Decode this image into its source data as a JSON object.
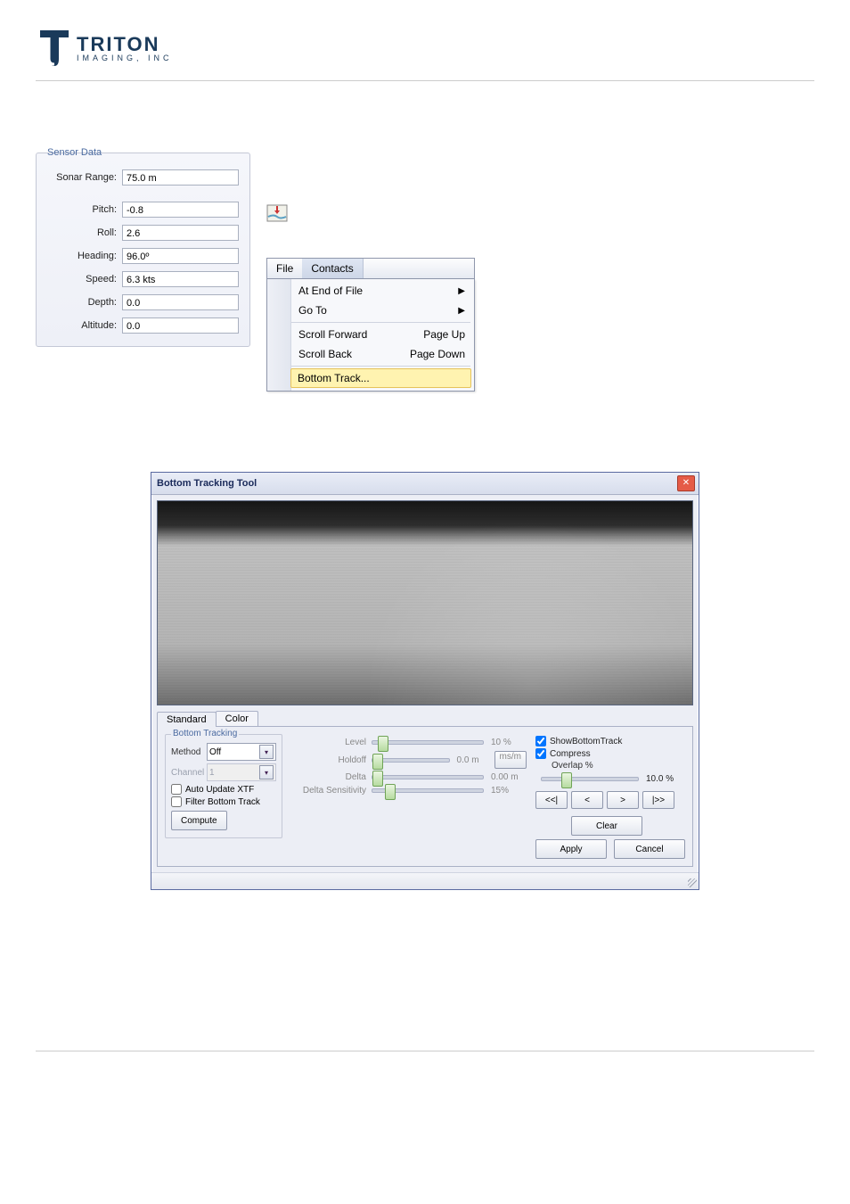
{
  "brand": {
    "name": "TRITON",
    "sub": "IMAGING, INC"
  },
  "sensor": {
    "legend": "Sensor Data",
    "rows": {
      "sonar_range": {
        "label": "Sonar Range:",
        "value": "75.0 m"
      },
      "pitch": {
        "label": "Pitch:",
        "value": "-0.8"
      },
      "roll": {
        "label": "Roll:",
        "value": "2.6"
      },
      "heading": {
        "label": "Heading:",
        "value": "96.0º"
      },
      "speed": {
        "label": "Speed:",
        "value": "6.3 kts"
      },
      "depth": {
        "label": "Depth:",
        "value": "0.0"
      },
      "altitude": {
        "label": "Altitude:",
        "value": "0.0"
      }
    }
  },
  "menu": {
    "bar": {
      "file": "File",
      "contacts": "Contacts"
    },
    "items": {
      "at_end": {
        "label": "At End of File",
        "accel": ""
      },
      "go_to": {
        "label": "Go To",
        "accel": ""
      },
      "scroll_f": {
        "label": "Scroll Forward",
        "accel": "Page Up"
      },
      "scroll_b": {
        "label": "Scroll Back",
        "accel": "Page Down"
      },
      "bottom": {
        "label": "Bottom Track...",
        "accel": ""
      }
    }
  },
  "tool": {
    "title": "Bottom Tracking Tool",
    "tabs": {
      "standard": "Standard",
      "color": "Color"
    },
    "bt_legend": "Bottom Tracking",
    "method_label": "Method",
    "method_value": "Off",
    "channel_label": "Channel",
    "channel_value": "1",
    "auto_update": "Auto Update XTF",
    "filter_bt": "Filter Bottom Track",
    "compute": "Compute",
    "sliders": {
      "level": {
        "label": "Level",
        "value": "10 %"
      },
      "holdoff": {
        "label": "Holdoff",
        "value": "0.0 m"
      },
      "delta": {
        "label": "Delta",
        "value": "0.00 m"
      },
      "dsens": {
        "label": "Delta Sensitivity",
        "value": "15%"
      }
    },
    "unit_btn": "ms/m",
    "right": {
      "show": "ShowBottomTrack",
      "compress": "Compress",
      "overlap_label": "Overlap %",
      "overlap_value": "10.0 %",
      "nav": {
        "first": "<<|",
        "prev": "<",
        "next": ">",
        "last": "|>>"
      },
      "clear": "Clear",
      "apply": "Apply",
      "cancel": "Cancel"
    }
  }
}
